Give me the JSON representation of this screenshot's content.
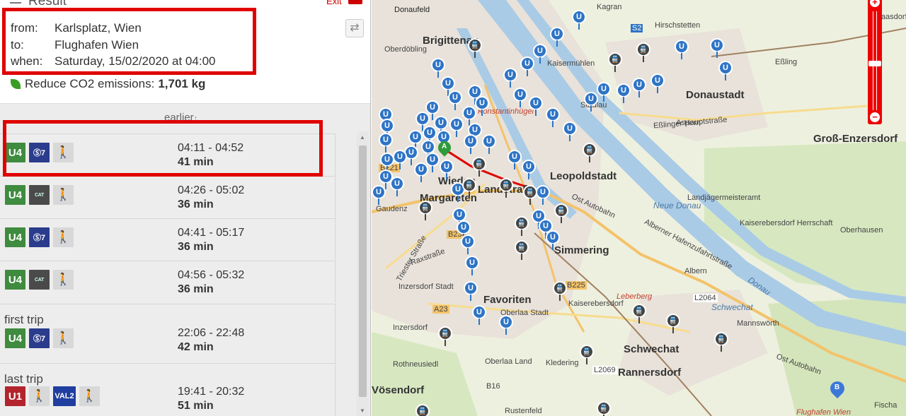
{
  "panel": {
    "title": "Result",
    "close_label": "Exit",
    "query": {
      "from_label": "from:",
      "from_value": "Karlsplatz, Wien",
      "to_label": "to:",
      "to_value": "Flughafen Wien",
      "when_label": "when:",
      "when_value": "Saturday, 15/02/2020 at 04:00"
    },
    "co2_label": "Reduce CO2 emissions:",
    "co2_value": "1,701 kg",
    "earlier_label": "earlier",
    "trips": [
      {
        "icons": [
          "U4",
          "S7",
          "walk"
        ],
        "time": "04:11 - 04:52",
        "duration": "41 min"
      },
      {
        "icons": [
          "U4",
          "CAT",
          "walk"
        ],
        "time": "04:26 - 05:02",
        "duration": "36 min"
      },
      {
        "icons": [
          "U4",
          "S7",
          "walk"
        ],
        "time": "04:41 - 05:17",
        "duration": "36 min"
      },
      {
        "icons": [
          "U4",
          "CAT",
          "walk"
        ],
        "time": "04:56 - 05:32",
        "duration": "36 min"
      }
    ],
    "first_trip": {
      "label": "first trip",
      "icons": [
        "U4",
        "S7",
        "walk"
      ],
      "time": "22:06 - 22:48",
      "duration": "42 min"
    },
    "last_trip": {
      "label": "last trip",
      "icons": [
        "U1",
        "walk",
        "VAL2",
        "walk"
      ],
      "time": "19:41 - 20:32",
      "duration": "51 min"
    },
    "icon_text": {
      "u4": "U4",
      "u1": "U1",
      "s7": "Ⓢ7",
      "cat": "CAT",
      "val2": "VAL2"
    }
  },
  "map": {
    "districts": [
      "Brigittenau",
      "Donaustadt",
      "Leopoldstadt",
      "Landstraße",
      "Margareten",
      "Wieden",
      "Simmering",
      "Favoriten",
      "Schwechat",
      "Rannersdorf",
      "Groß-Enzersdorf"
    ],
    "labels": {
      "donaufeld": "Donaufeld",
      "kagran": "Kagran",
      "hirschstetten": "Hirschstetten",
      "raasdorf": "Raasdorf",
      "kaisermuhlen": "Kaisermühlen",
      "essling": "Eßling",
      "stadlau": "Stadlau",
      "aspern": "Aspern",
      "oberdobling": "Oberdöbling",
      "landjaeger": "Landjägermeisteramt",
      "kaiserebersdorf_herr": "Kaiserebersdorf Herrschaft",
      "oberhausen": "Oberhausen",
      "albern": "Albern",
      "mannswoerth": "Mannswörth",
      "kaiserebersdorf": "Kaiserebersdorf",
      "inzersdorf_stadt": "Inzersdorf Stadt",
      "inzersdorf": "Inzersdorf",
      "oberlaa_stadt": "Oberlaa Stadt",
      "oberlaa_land": "Oberlaa Land",
      "kledering": "Kledering",
      "rothneusiedl": "Rothneusiedl",
      "vosendorf": "Vösendorf",
      "rustenfeld": "Rustenfeld",
      "gaudenz": "Gaudenz",
      "fischa": "Fischa",
      "flughafen": "Flughafen Wien",
      "konstantin": "Konstantinhügel",
      "leberberg": "Leberberg",
      "neue_donau": "Neue Donau",
      "donau": "Donau",
      "schwechat_river": "Schwechat",
      "road_essling": "Eßlinger Hauptstraße",
      "road_ost": "Ost Autobahn",
      "road_ost2": "Ost Autobahn",
      "road_alberner": "Alberner Hafenzufahrtstraße",
      "road_raxstr": "Raxstraße",
      "road_triester": "Triester Straße",
      "b230": "B230",
      "b225": "B225",
      "a23": "A23",
      "b16": "B16",
      "l2069": "L2069",
      "l2064": "L2064",
      "s2": "S2",
      "b221": "B221"
    },
    "marker_a": "A",
    "marker_b": "B",
    "zoom": {
      "plus": "+",
      "minus": "−"
    },
    "colors": {
      "water": "#a9cbe6",
      "park": "#cfe3b5",
      "urban": "#e9e3dc",
      "highlight": "#e00000",
      "ubahn": "#2e74c6"
    }
  }
}
